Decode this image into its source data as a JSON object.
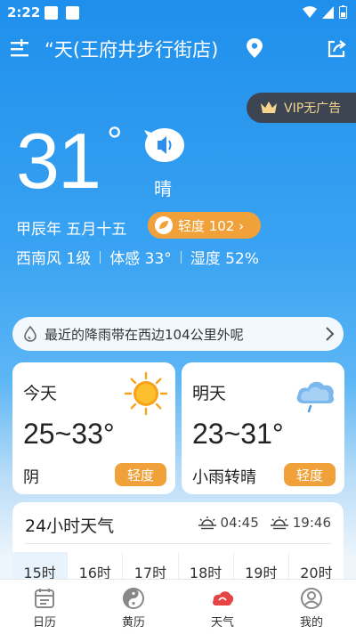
{
  "status": {
    "time": "2:22"
  },
  "header": {
    "location": "“天(王府井步行街店)"
  },
  "vip": {
    "label": "VIP无广告"
  },
  "current": {
    "temp": "31",
    "deg": "°",
    "condition": "晴",
    "lunar": "甲辰年 五月十五",
    "aqi": "轻度 102 ›",
    "wind": "西南风 1级",
    "feels": "体感 33°",
    "humidity": "湿度 52%"
  },
  "rain_alert": {
    "text": "最近的降雨带在西边104公里外呢"
  },
  "forecast": [
    {
      "day": "今天",
      "range": "25~33°",
      "condition": "阴",
      "aqi": "轻度"
    },
    {
      "day": "明天",
      "range": "23~31°",
      "condition": "小雨转晴",
      "aqi": "轻度"
    }
  ],
  "hourly": {
    "title": "24小时天气",
    "sunrise": "04:45",
    "sunset": "19:46",
    "hours": [
      "15时",
      "16时",
      "17时",
      "18时",
      "19时",
      "20时"
    ]
  },
  "tabs": [
    {
      "label": "日历",
      "icon": "calendar-icon"
    },
    {
      "label": "黄历",
      "icon": "yin-yang-icon"
    },
    {
      "label": "天气",
      "icon": "weather-icon"
    },
    {
      "label": "我的",
      "icon": "profile-icon"
    }
  ],
  "colors": {
    "accent": "#f0a13a",
    "sky": "#1e8fec",
    "tab_active": "#e64545"
  }
}
